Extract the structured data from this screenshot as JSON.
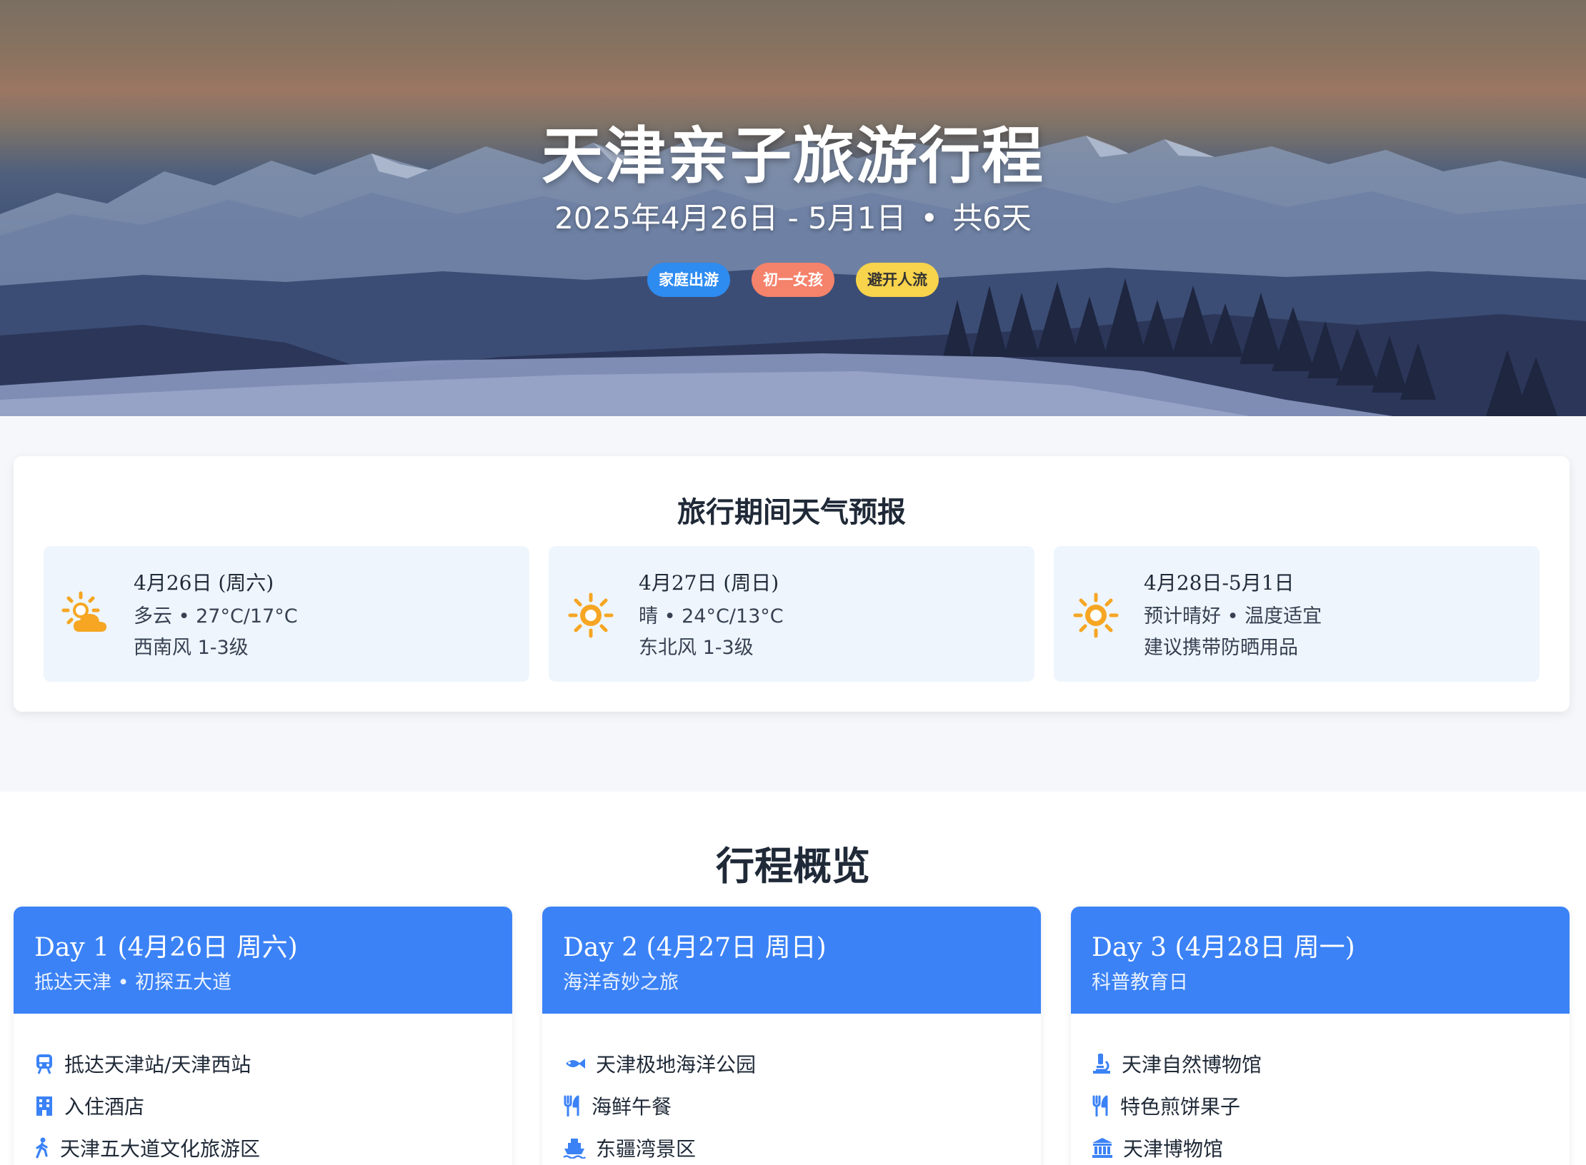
{
  "hero": {
    "title": "天津亲子旅游行程",
    "date_range": "2025年4月26日 - 5月1日",
    "separator": "•",
    "duration": "共6天",
    "tags": [
      {
        "label": "家庭出游",
        "color": "#2e8bf0"
      },
      {
        "label": "初一女孩",
        "color": "#f5826b"
      },
      {
        "label": "避开人流",
        "color": "#f8d34c"
      }
    ]
  },
  "weather": {
    "title": "旅行期间天气预报",
    "days": [
      {
        "date": "4月26日 (周六)",
        "line1": "多云 • 27°C/17°C",
        "line2": "西南风 1-3级",
        "icon": "partly-cloudy-icon"
      },
      {
        "date": "4月27日 (周日)",
        "line1": "晴 • 24°C/13°C",
        "line2": "东北风 1-3级",
        "icon": "sun-icon"
      },
      {
        "date": "4月28日-5月1日",
        "line1": "预计晴好 • 温度适宜",
        "line2": "建议携带防晒用品",
        "icon": "sun-icon"
      }
    ]
  },
  "itinerary": {
    "title": "行程概览",
    "days": [
      {
        "title": "Day 1 (4月26日 周六)",
        "subtitle": "抵达天津 • 初探五大道",
        "items": [
          {
            "icon": "train-icon",
            "label": "抵达天津站/天津西站"
          },
          {
            "icon": "hotel-icon",
            "label": "入住酒店"
          },
          {
            "icon": "walking-icon",
            "label": "天津五大道文化旅游区"
          }
        ]
      },
      {
        "title": "Day 2 (4月27日 周日)",
        "subtitle": "海洋奇妙之旅",
        "items": [
          {
            "icon": "fish-icon",
            "label": "天津极地海洋公园"
          },
          {
            "icon": "utensils-icon",
            "label": "海鲜午餐"
          },
          {
            "icon": "ship-icon",
            "label": "东疆湾景区"
          }
        ]
      },
      {
        "title": "Day 3 (4月28日 周一)",
        "subtitle": "科普教育日",
        "items": [
          {
            "icon": "microscope-icon",
            "label": "天津自然博物馆"
          },
          {
            "icon": "utensils-icon",
            "label": "特色煎饼果子"
          },
          {
            "icon": "museum-icon",
            "label": "天津博物馆"
          }
        ]
      }
    ]
  }
}
